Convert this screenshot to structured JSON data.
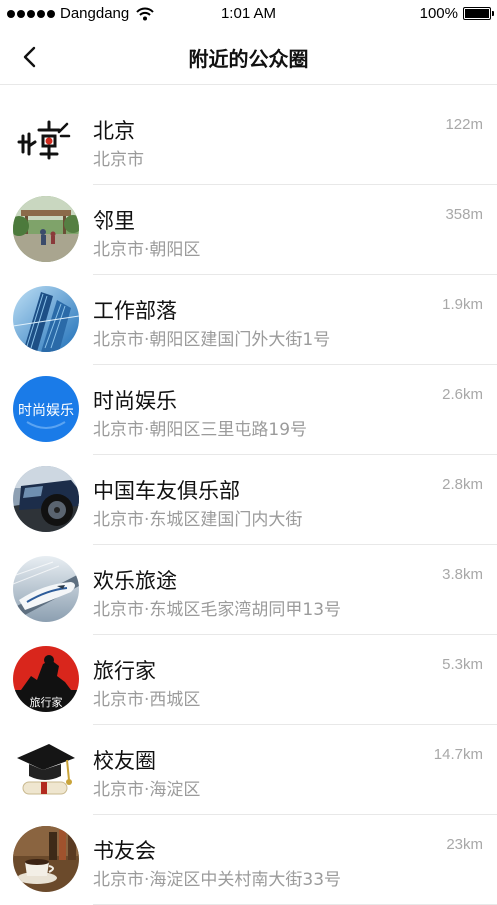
{
  "status_bar": {
    "carrier": "Dangdang",
    "time": "1:01 AM",
    "battery": "100%"
  },
  "header": {
    "title": "附近的公众圈",
    "back_icon": "chevron-left-icon"
  },
  "circles": [
    {
      "name": "北京",
      "address": "北京市",
      "distance": "122m",
      "avatar": "beijing-logo"
    },
    {
      "name": "邻里",
      "address": "北京市·朝阳区",
      "distance": "358m",
      "avatar": "neighborhood-photo"
    },
    {
      "name": "工作部落",
      "address": "北京市·朝阳区建国门外大街1号",
      "distance": "1.9km",
      "avatar": "office-building-photo"
    },
    {
      "name": "时尚娱乐",
      "address": "北京市·朝阳区三里屯路19号",
      "distance": "2.6km",
      "avatar": "fashion-entertainment-logo",
      "avatar_text": "时尚娱乐"
    },
    {
      "name": "中国车友俱乐部",
      "address": "北京市·东城区建国门内大街",
      "distance": "2.8km",
      "avatar": "car-photo"
    },
    {
      "name": "欢乐旅途",
      "address": "北京市·东城区毛家湾胡同甲13号",
      "distance": "3.8km",
      "avatar": "train-photo"
    },
    {
      "name": "旅行家",
      "address": "北京市·西城区",
      "distance": "5.3km",
      "avatar": "traveler-logo",
      "avatar_text": "旅行家"
    },
    {
      "name": "校友圈",
      "address": "北京市·海淀区",
      "distance": "14.7km",
      "avatar": "graduation-cap-photo"
    },
    {
      "name": "书友会",
      "address": "北京市·海淀区中关村南大街33号",
      "distance": "23km",
      "avatar": "books-coffee-photo"
    }
  ],
  "colors": {
    "fashion_blue": "#1a7be8",
    "traveler_red": "#d9261c",
    "secondary_text": "#9b9b9b",
    "distance_text": "#a8a8a8"
  }
}
